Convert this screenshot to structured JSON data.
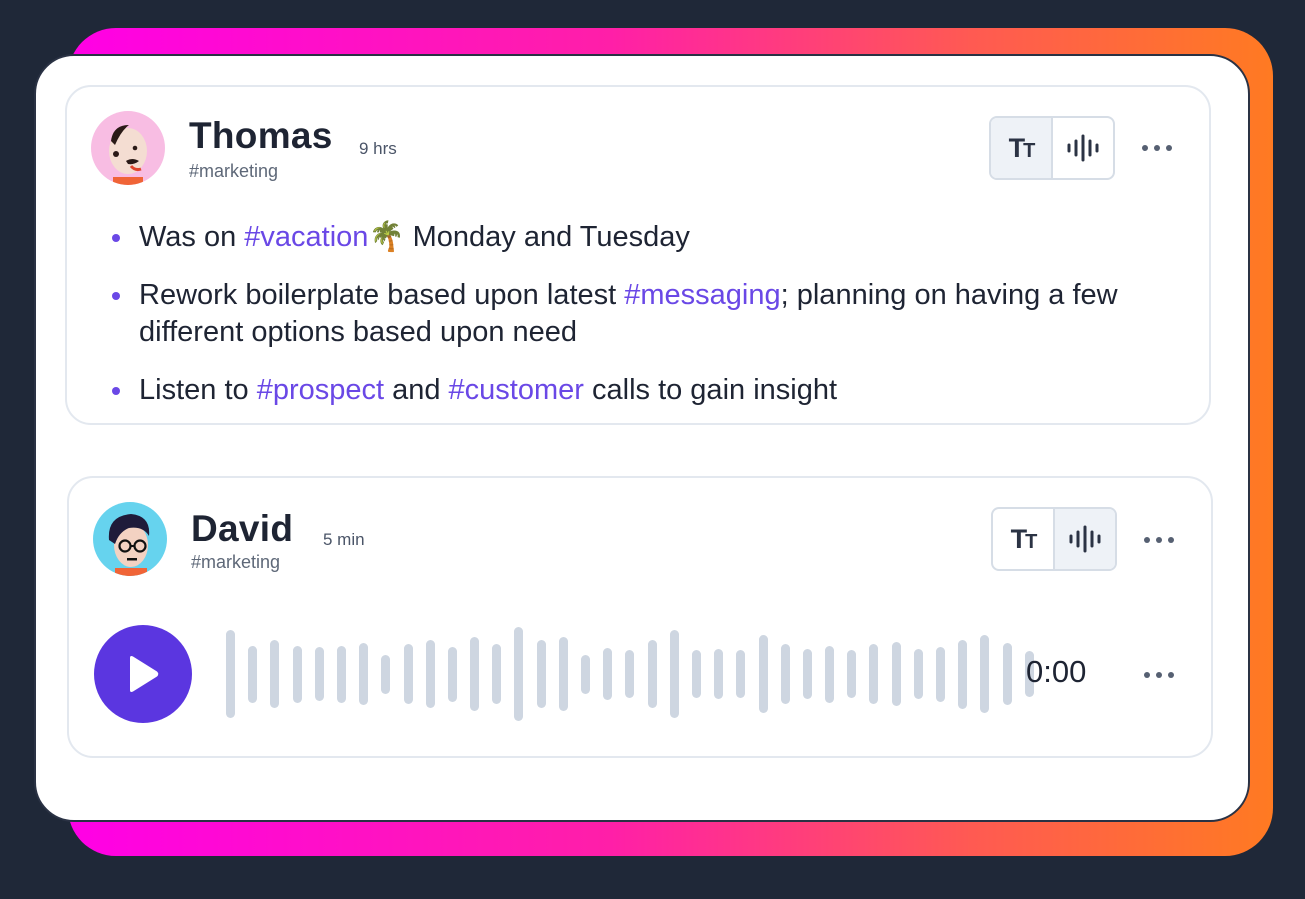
{
  "posts": [
    {
      "author": "Thomas",
      "time": "9 hrs",
      "channel": "#marketing",
      "toggle": {
        "text_label": "TT",
        "active": "text"
      },
      "bullets": [
        [
          {
            "t": "Was on ",
            "tag": false
          },
          {
            "t": "#vacation",
            "tag": true
          },
          {
            "t": "🌴 Monday and Tuesday",
            "tag": false
          }
        ],
        [
          {
            "t": "Rework boilerplate based upon latest ",
            "tag": false
          },
          {
            "t": "#messaging",
            "tag": true
          },
          {
            "t": "; planning on having a few different options based upon need",
            "tag": false
          }
        ],
        [
          {
            "t": "Listen to ",
            "tag": false
          },
          {
            "t": "#prospect",
            "tag": true
          },
          {
            "t": " and ",
            "tag": false
          },
          {
            "t": "#customer",
            "tag": true
          },
          {
            "t": " calls to gain insight",
            "tag": false
          }
        ]
      ]
    },
    {
      "author": "David",
      "time": "5 min",
      "channel": "#marketing",
      "toggle": {
        "text_label": "TT",
        "active": "audio"
      },
      "audio": {
        "duration": "0:00",
        "waveform_levels": [
          0.88,
          0.57,
          0.68,
          0.57,
          0.54,
          0.57,
          0.62,
          0.39,
          0.6,
          0.68,
          0.55,
          0.74,
          0.6,
          0.94,
          0.68,
          0.74,
          0.39,
          0.52,
          0.48,
          0.68,
          0.88,
          0.48,
          0.5,
          0.48,
          0.78,
          0.6,
          0.5,
          0.57,
          0.48,
          0.6,
          0.64,
          0.5,
          0.55,
          0.69,
          0.78,
          0.62,
          0.46
        ]
      }
    }
  ],
  "colors": {
    "accent": "#6a48e6",
    "play_button": "#5b36e0",
    "waveform": "#ced6e1",
    "frame_gradient": [
      "#ff00e6",
      "#ff7a22"
    ],
    "background": "#1f2838"
  }
}
